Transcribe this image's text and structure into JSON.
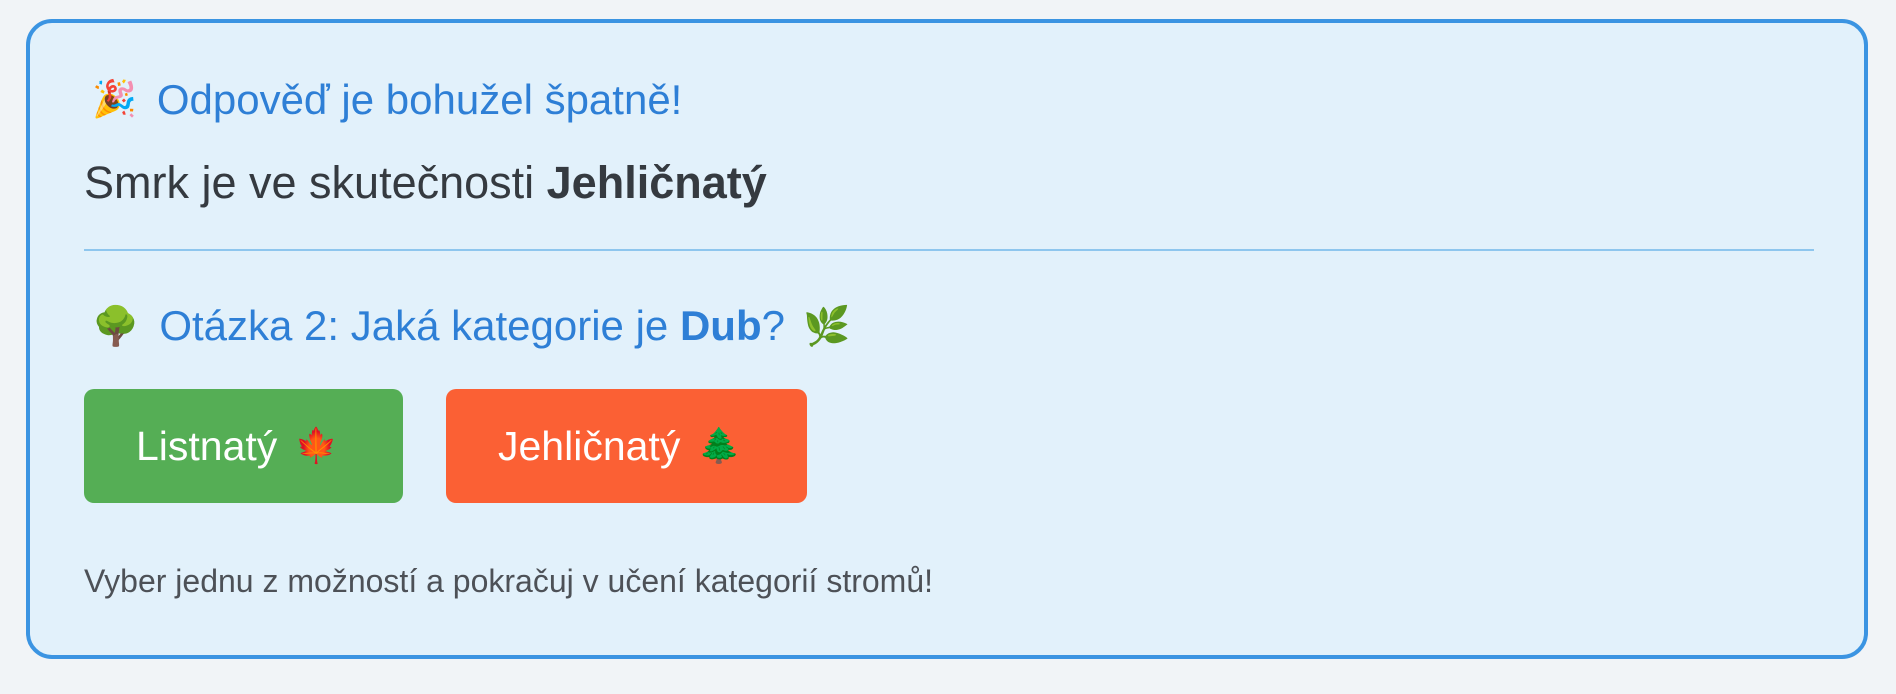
{
  "feedback": {
    "icon": "🎉",
    "icon_name": "party-popper-icon",
    "title": "Odpověď je bohužel špatně!",
    "text_prefix": "Smrk je ve skutečnosti ",
    "correct_answer": "Jehličnatý"
  },
  "question": {
    "icon": "🌳",
    "icon_name": "deciduous-tree-icon",
    "prefix": "Otázka 2: Jaká kategorie je ",
    "subject": "Dub",
    "suffix": "?",
    "trailing_icon": "🌿",
    "trailing_icon_name": "herb-icon"
  },
  "answers": [
    {
      "label": "Listnatý",
      "icon": "🍁",
      "icon_name": "maple-leaf-icon",
      "color": "#55ae55"
    },
    {
      "label": "Jehličnatý",
      "icon": "🌲",
      "icon_name": "evergreen-tree-icon",
      "color": "#fb6034"
    }
  ],
  "hint": "Vyber jednu z možností a pokračuj v učení kategorií stromů!",
  "colors": {
    "card_border": "#3b94e2",
    "card_background": "#e2f1fb",
    "accent_text": "#2e7fd6",
    "divider": "#8ec6ee"
  }
}
